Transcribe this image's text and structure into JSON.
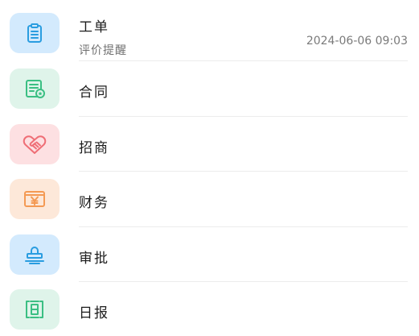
{
  "items": [
    {
      "title": "工单",
      "subtitle": "评价提醒",
      "time": "2024-06-06 09:03",
      "icon": "clipboard-icon",
      "tile_color": "#d3eafd",
      "icon_color": "#2a9de0"
    },
    {
      "title": "合同",
      "icon": "contract-icon",
      "tile_color": "#dff4ea",
      "icon_color": "#3bbf83"
    },
    {
      "title": "招商",
      "icon": "handshake-icon",
      "tile_color": "#fde0e2",
      "icon_color": "#ef6e76"
    },
    {
      "title": "财务",
      "icon": "yuan-icon",
      "tile_color": "#fde8d9",
      "icon_color": "#f49a54"
    },
    {
      "title": "审批",
      "icon": "stamp-icon",
      "tile_color": "#d3eafd",
      "icon_color": "#2a9de0"
    },
    {
      "title": "日报",
      "icon": "daily-report-icon",
      "tile_color": "#dff4ea",
      "icon_color": "#3bbf83"
    }
  ]
}
